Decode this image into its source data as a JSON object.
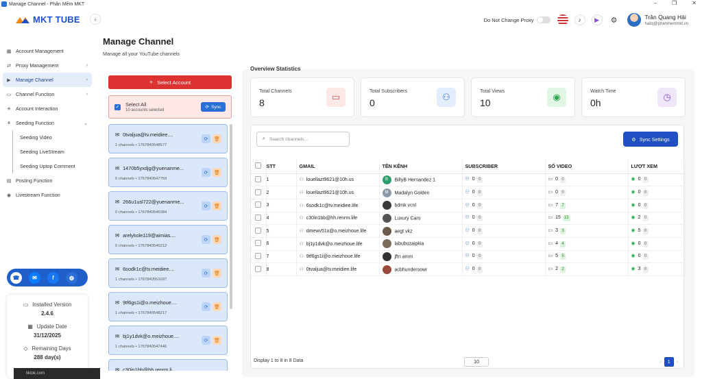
{
  "window": {
    "title": "Manage Channel - Phần Mềm MKT",
    "min": "–",
    "restore": "❐",
    "close": "✕"
  },
  "logo": {
    "text": "MKT TUBE"
  },
  "sidebar": {
    "items": [
      {
        "label": "Account Management",
        "icon": "grid-icon"
      },
      {
        "label": "Proxy Management",
        "icon": "proxy-icon",
        "chevron": "›"
      },
      {
        "label": "Manage Channel",
        "icon": "channel-icon",
        "chevron": "›",
        "active": true
      },
      {
        "label": "Channel Function",
        "icon": "function-icon",
        "chevron": "›"
      },
      {
        "label": "Account Interaction",
        "icon": "interaction-icon"
      },
      {
        "label": "Seeding Function",
        "icon": "seeding-icon",
        "chevron": "⌄"
      }
    ],
    "seeding_sub": [
      "Seeding Video",
      "Seeding LiveStream",
      "Seeding Uptop Comment"
    ],
    "items2": [
      {
        "label": "Posting Function",
        "icon": "posting-icon"
      },
      {
        "label": "Livestream Function",
        "icon": "livestream-icon"
      }
    ]
  },
  "version": {
    "installed_label": "Installed Version",
    "installed_value": "2.4.6",
    "update_label": "Update Date",
    "update_value": "31/12/2025",
    "remaining_label": "Remaining Days",
    "remaining_value": "288 day(s)"
  },
  "taskbar": {
    "text": "tiktok.com"
  },
  "header": {
    "proxy_label": "Do Not Change Proxy",
    "user_name": "Trần Quang Hải",
    "user_email": "haitq@phanmemmkt.vn"
  },
  "page": {
    "title": "Manage Channel",
    "subtitle": "Manage all your YouTube channels"
  },
  "left": {
    "select_account": "Select Account",
    "select_all": "Select All",
    "selected_count": "10 accounts selected",
    "sync": "Sync"
  },
  "accounts": [
    {
      "email": "0tvaljua@tv.meidiee....",
      "channels": "1 channels",
      "id": "1767840548577"
    },
    {
      "email": "1470b5yxdjg@yuenanme...",
      "channels": "0 channels",
      "id": "1767840547759"
    },
    {
      "email": "266u1usl722@yuenanme...",
      "channels": "0 channels",
      "id": "1767840546384"
    },
    {
      "email": "arelykole119@aimias....",
      "channels": "0 channels",
      "id": "1767840546212"
    },
    {
      "email": "6sodk1c@tv.meidiee....",
      "channels": "1 channels",
      "id": "1767840551037"
    },
    {
      "email": "9tf6gs1i@o.meizhoue....",
      "channels": "1 channels",
      "id": "1767840548217"
    },
    {
      "email": "bj1y1dvk@o.meizhoue....",
      "channels": "1 channels",
      "id": "1767840547446"
    },
    {
      "email": "c30in1bb@hh.renrm.li...",
      "channels": "",
      "id": ""
    }
  ],
  "overview": {
    "title": "Overview Statistics",
    "stats": [
      {
        "label": "Total Channels",
        "value": "8",
        "icon": "video-icon",
        "color": "#e05555",
        "bg": "#fde8e8"
      },
      {
        "label": "Total Subscribers",
        "value": "0",
        "icon": "users-icon",
        "color": "#2a6fd6",
        "bg": "#e3eefc"
      },
      {
        "label": "Total Views",
        "value": "10",
        "icon": "eye-icon",
        "color": "#2aa84a",
        "bg": "#e2f6e6"
      },
      {
        "label": "Watch Time",
        "value": "0h",
        "icon": "clock-icon",
        "color": "#8a4fc9",
        "bg": "#efe6fa"
      }
    ]
  },
  "table": {
    "search_placeholder": "Search channels...",
    "sync_settings": "Sync Settings",
    "headers": [
      "STT",
      "GMAIL",
      "TÊN KÊNH",
      "SUBSCRIBER",
      "SỐ VIDEO",
      "LƯỢT XEM"
    ],
    "rows": [
      {
        "stt": "1",
        "gmail": "louellazt9621@10h.us",
        "name": "BillyB Hernandez 1",
        "av": "B",
        "avc": "#2e9e6e",
        "sub": "0",
        "subb": "0",
        "vid": "0",
        "vidb": "0",
        "view": "0",
        "viewb": "0"
      },
      {
        "stt": "2",
        "gmail": "louellazt9621@10h.us",
        "name": "Madalyn Golden",
        "av": "M",
        "avc": "#8a9aa8",
        "sub": "0",
        "subb": "0",
        "vid": "0",
        "vidb": "0",
        "view": "0",
        "viewb": "0"
      },
      {
        "stt": "3",
        "gmail": "6sodk1c@tv.meidiee.life",
        "name": "bdmk vcnl",
        "av": "",
        "avc": "#3a3a3a",
        "sub": "0",
        "subb": "0",
        "vid": "7",
        "vidb": "7",
        "view": "0",
        "viewb": "0"
      },
      {
        "stt": "4",
        "gmail": "c30in1bb@hh.renrm.life",
        "name": "Luxury Cars",
        "av": "",
        "avc": "#555",
        "sub": "0",
        "subb": "0",
        "vid": "15",
        "vidb": "15",
        "view": "2",
        "viewb": "0"
      },
      {
        "stt": "5",
        "gmail": "dmewv51x@o.meizhoue.life",
        "name": "aegt vkz",
        "av": "",
        "avc": "#6b5a4a",
        "sub": "0",
        "subb": "0",
        "vid": "3",
        "vidb": "3",
        "view": "5",
        "viewb": "0"
      },
      {
        "stt": "6",
        "gmail": "bj1y1dvk@o.meizhoue.life",
        "name": "labubuzaipkia",
        "av": "",
        "avc": "#7a6a5a",
        "sub": "0",
        "subb": "0",
        "vid": "4",
        "vidb": "4",
        "view": "0",
        "viewb": "0"
      },
      {
        "stt": "7",
        "gmail": "9tf6gs1i@o.meizhoue.life",
        "name": "jftn amm",
        "av": "",
        "avc": "#333",
        "sub": "0",
        "subb": "0",
        "vid": "5",
        "vidb": "5",
        "view": "0",
        "viewb": "0"
      },
      {
        "stt": "8",
        "gmail": "0tvaljua@tv.meidiee.life",
        "name": "acbhundersowr",
        "av": "",
        "avc": "#9a4a3a",
        "sub": "0",
        "subb": "0",
        "vid": "2",
        "vidb": "2",
        "view": "3",
        "viewb": "0"
      }
    ],
    "footer": "Display 1 to 8 in 8 Data",
    "page_size": "10",
    "prev": "‹",
    "page": "1",
    "next": "›"
  }
}
